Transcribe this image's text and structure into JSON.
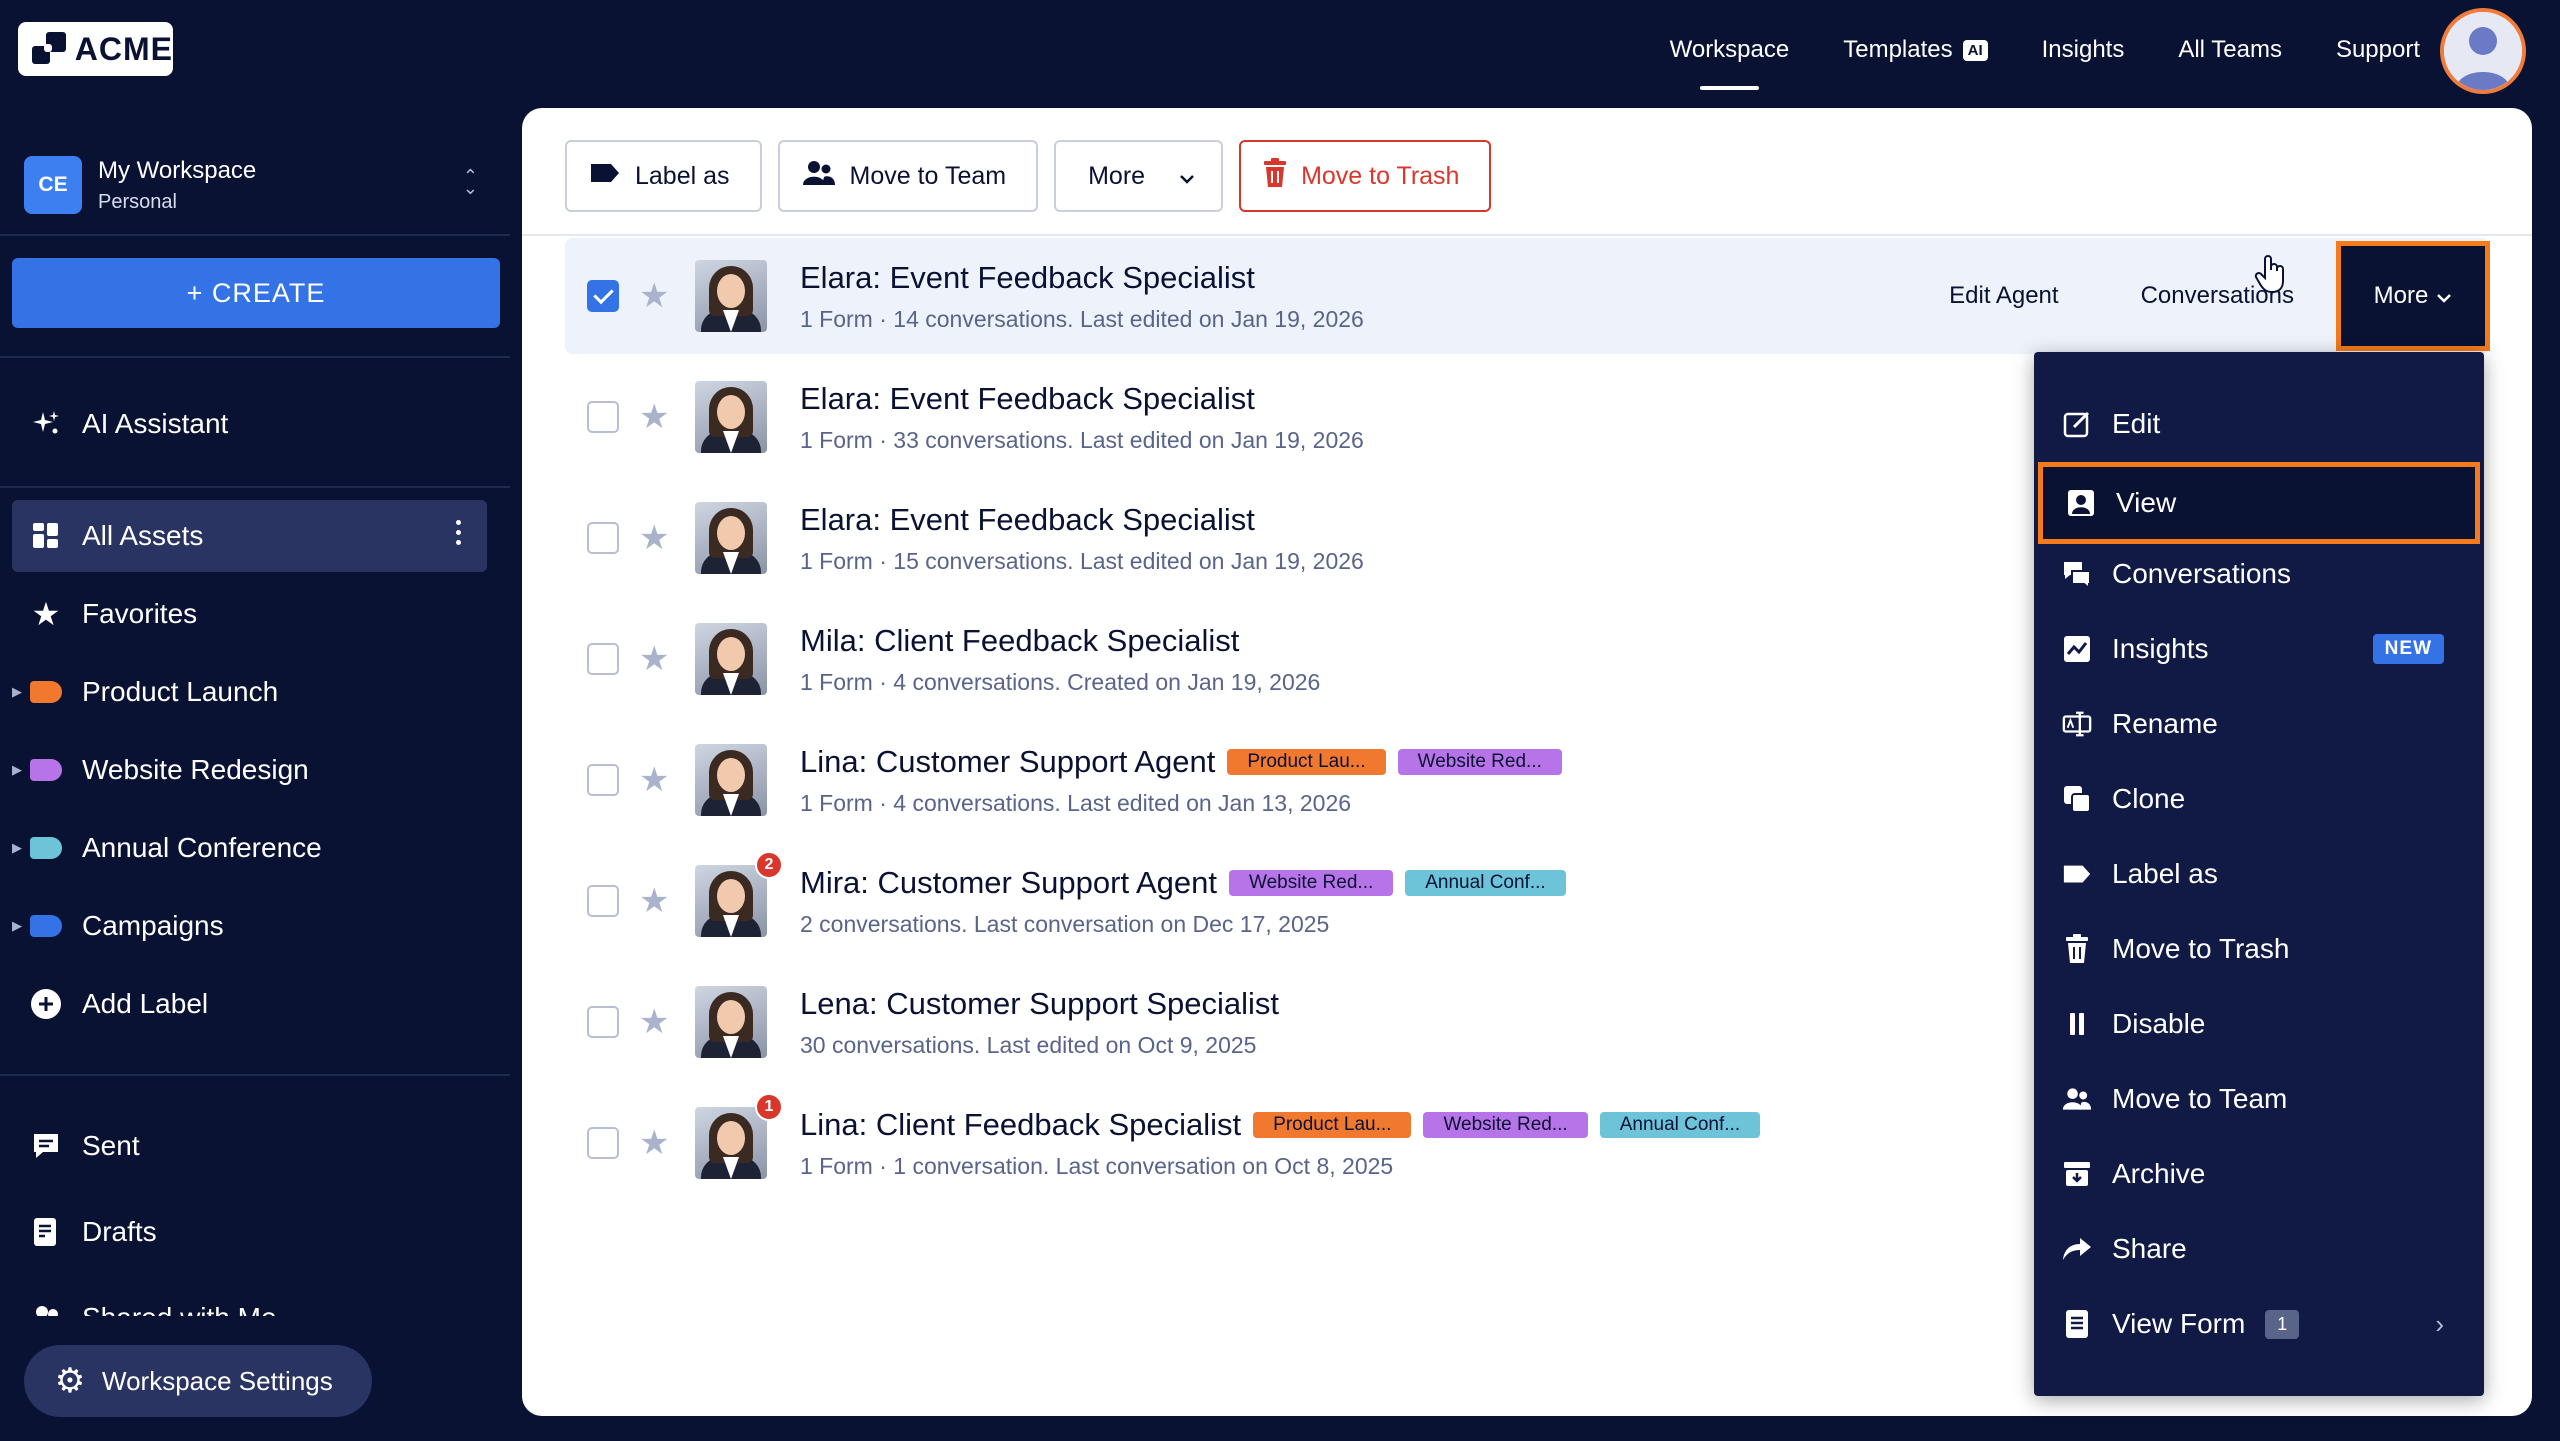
{
  "brand": {
    "logo_text": "ACME"
  },
  "topnav": [
    {
      "label": "Workspace",
      "active": true
    },
    {
      "label": "Templates",
      "badge": "AI"
    },
    {
      "label": "Insights"
    },
    {
      "label": "All Teams"
    },
    {
      "label": "Support"
    }
  ],
  "workspace": {
    "initials": "CE",
    "name": "My Workspace",
    "type": "Personal"
  },
  "sidebar": {
    "create_label": "+ CREATE",
    "ai_assistant": "AI Assistant",
    "all_assets": "All Assets",
    "favorites": "Favorites",
    "labels": [
      {
        "name": "Product Launch",
        "color": "#f1782f"
      },
      {
        "name": "Website Redesign",
        "color": "#b774e8"
      },
      {
        "name": "Annual Conference",
        "color": "#6dc4d9"
      },
      {
        "name": "Campaigns",
        "color": "#3473e6"
      }
    ],
    "add_label": "Add Label",
    "sent": "Sent",
    "drafts": "Drafts",
    "shared": "Shared with Me",
    "settings": "Workspace Settings"
  },
  "toolbar": {
    "label_as": "Label as",
    "move_to_team": "Move to Team",
    "more": "More",
    "move_to_trash": "Move to Trash"
  },
  "row_actions": {
    "edit_agent": "Edit Agent",
    "conversations": "Conversations",
    "more": "More"
  },
  "agents": [
    {
      "title": "Elara: Event Feedback Specialist",
      "meta": "1 Form · 14 conversations. Last edited on Jan 19, 2026",
      "checked": true,
      "tags": []
    },
    {
      "title": "Elara: Event Feedback Specialist",
      "meta": "1 Form · 33 conversations. Last edited on Jan 19, 2026",
      "tags": []
    },
    {
      "title": "Elara: Event Feedback Specialist",
      "meta": "1 Form · 15 conversations. Last edited on Jan 19, 2026",
      "tags": []
    },
    {
      "title": "Mila: Client Feedback Specialist",
      "meta": "1 Form · 4 conversations. Created on Jan 19, 2026",
      "tags": []
    },
    {
      "title": "Lina: Customer Support Agent",
      "meta": "1 Form · 4 conversations. Last edited on Jan 13, 2026",
      "tags": [
        [
          "Product Lau...",
          "product"
        ],
        [
          "Website Red...",
          "website"
        ]
      ]
    },
    {
      "title": "Mira: Customer Support Agent",
      "meta": "2 conversations. Last conversation on Dec 17, 2025",
      "badge": "2",
      "tags": [
        [
          "Website Red...",
          "website"
        ],
        [
          "Annual Conf...",
          "annual"
        ]
      ]
    },
    {
      "title": "Lena: Customer Support Specialist",
      "meta": "30 conversations. Last edited on Oct 9, 2025",
      "tags": []
    },
    {
      "title": "Lina: Client Feedback Specialist",
      "meta": "1 Form · 1 conversation. Last conversation on Oct 8, 2025",
      "badge": "1",
      "tags": [
        [
          "Product Lau...",
          "product"
        ],
        [
          "Website Red...",
          "website"
        ],
        [
          "Annual Conf...",
          "annual"
        ]
      ]
    }
  ],
  "menu": {
    "edit": "Edit",
    "view": "View",
    "conversations": "Conversations",
    "insights": "Insights",
    "new_badge": "NEW",
    "rename": "Rename",
    "clone": "Clone",
    "label_as": "Label as",
    "move_to_trash": "Move to Trash",
    "disable": "Disable",
    "move_to_team": "Move to Team",
    "archive": "Archive",
    "share": "Share",
    "view_form": "View Form",
    "view_form_count": "1"
  }
}
